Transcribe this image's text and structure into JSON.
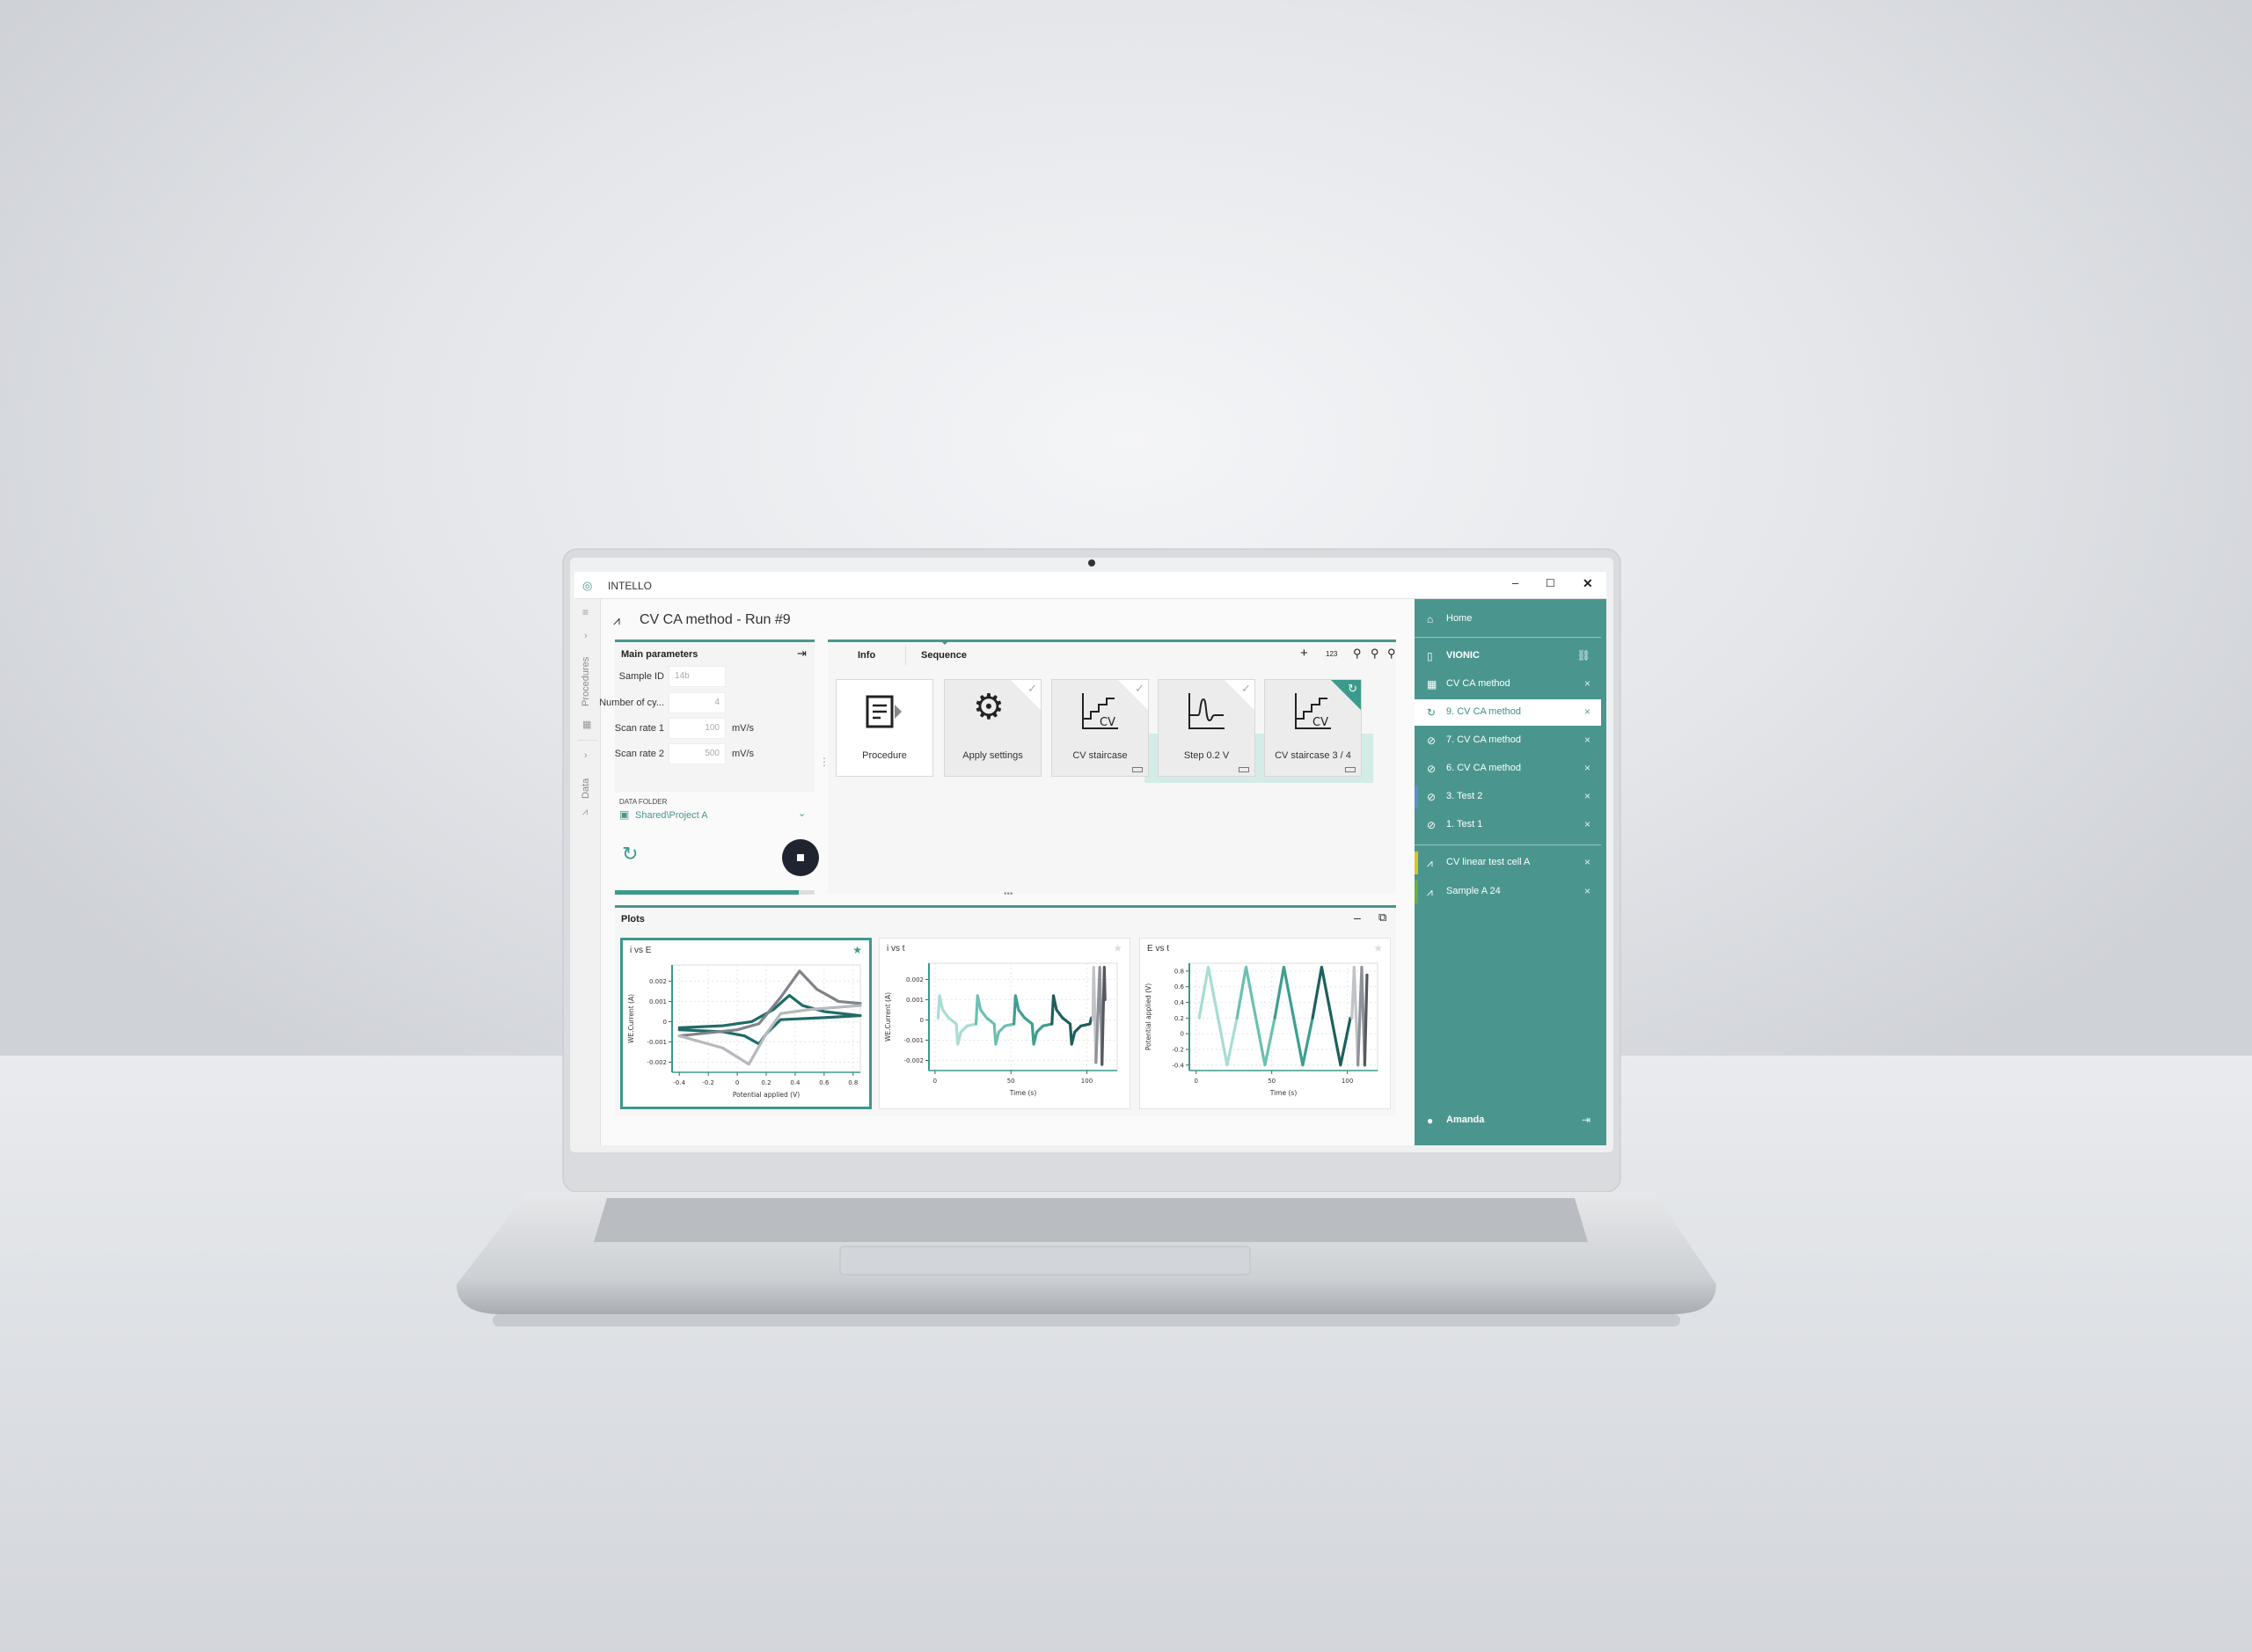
{
  "app": {
    "name": "INTELLO",
    "window_controls": [
      "minimize",
      "maximize",
      "close"
    ]
  },
  "nav": {
    "procedures": "Procedures",
    "data": "Data"
  },
  "run": {
    "title": "CV CA method - Run #9"
  },
  "params": {
    "heading": "Main parameters",
    "fields": [
      {
        "label": "Sample ID",
        "value": "14b",
        "unit": ""
      },
      {
        "label": "Number of cy...",
        "value": "4",
        "unit": ""
      },
      {
        "label": "Scan rate 1",
        "value": "100",
        "unit": "mV/s"
      },
      {
        "label": "Scan rate 2",
        "value": "500",
        "unit": "mV/s"
      }
    ],
    "data_folder_label": "DATA FOLDER",
    "data_folder": "Shared\\Project A",
    "progress": 0.92
  },
  "sequence": {
    "tabs": [
      {
        "label": "Info"
      },
      {
        "label": "Sequence",
        "active": true
      }
    ],
    "toolbar": [
      "add-icon",
      "numbering-icon",
      "zoom-fit-icon",
      "zoom-out-icon",
      "zoom-in-icon"
    ],
    "numbering_label": "123",
    "cards": [
      {
        "label": "Procedure",
        "state": "none",
        "icon": "procedure-icon"
      },
      {
        "label": "Apply settings",
        "state": "done",
        "icon": "gear-icon"
      },
      {
        "label": "CV staircase",
        "state": "done",
        "icon": "cv-staircase-icon",
        "icon_text": "CV"
      },
      {
        "label": "Step 0.2 V",
        "state": "done",
        "icon": "step-icon"
      },
      {
        "label": "CV staircase 3 / 4",
        "state": "running",
        "icon": "cv-staircase-icon",
        "icon_text": "CV"
      }
    ]
  },
  "plots": {
    "heading": "Plots"
  },
  "colors": {
    "accent": "#4a968e",
    "sidebar": "#4a968e",
    "stop": "#1e2430"
  },
  "sidebar": {
    "home": "Home",
    "instrument": "VIONIC",
    "items": [
      {
        "label": "CV CA method",
        "icon": "procedure-grid-icon"
      },
      {
        "label": "9. CV CA method",
        "icon": "running-icon",
        "active": true
      },
      {
        "label": "7. CV CA method",
        "icon": "check-circle-icon"
      },
      {
        "label": "6. CV CA method",
        "icon": "check-circle-icon"
      },
      {
        "label": "3. Test 2",
        "icon": "check-circle-icon",
        "color": "#5b8fcf"
      },
      {
        "label": "1. Test 1",
        "icon": "check-circle-icon"
      }
    ],
    "data_items": [
      {
        "label": "CV linear test cell A",
        "color": "#d8c430"
      },
      {
        "label": "Sample A 24",
        "color": "#6aae4c"
      }
    ],
    "user": "Amanda"
  },
  "chart_data": [
    {
      "type": "line",
      "title": "i vs E",
      "favorite": true,
      "xlabel": "Potential applied (V)",
      "ylabel": "WE.Current (A)",
      "xlim": [
        -0.45,
        0.85
      ],
      "ylim": [
        -0.0025,
        0.0028
      ],
      "xticks": [
        -0.4,
        -0.2,
        0,
        0.2,
        0.4,
        0.6,
        0.8
      ],
      "yticks": [
        -0.002,
        -0.001,
        0,
        0.001,
        0.002
      ],
      "grid": true,
      "series": [
        {
          "color": "#1f6b68",
          "points": [
            [
              -0.4,
              -0.0003
            ],
            [
              -0.1,
              -0.0002
            ],
            [
              0.1,
              0.0
            ],
            [
              0.25,
              0.0006
            ],
            [
              0.36,
              0.0013
            ],
            [
              0.45,
              0.0008
            ],
            [
              0.6,
              0.0005
            ],
            [
              0.85,
              0.0003
            ],
            [
              0.6,
              0.0002
            ],
            [
              0.3,
              0.0001
            ],
            [
              0.2,
              -0.0006
            ],
            [
              0.15,
              -0.0011
            ],
            [
              0.05,
              -0.0007
            ],
            [
              -0.1,
              -0.0005
            ],
            [
              -0.4,
              -0.0004
            ]
          ]
        },
        {
          "color": "#80838a",
          "points": [
            [
              -0.4,
              -0.0007
            ],
            [
              0,
              -0.0004
            ],
            [
              0.15,
              -0.0001
            ],
            [
              0.3,
              0.0012
            ],
            [
              0.43,
              0.0025
            ],
            [
              0.55,
              0.0016
            ],
            [
              0.7,
              0.001
            ],
            [
              0.85,
              0.0009
            ]
          ]
        },
        {
          "color": "#b5b8bd",
          "points": [
            [
              0.85,
              0.0008
            ],
            [
              0.5,
              0.0006
            ],
            [
              0.3,
              0.0004
            ],
            [
              0.2,
              -0.0006
            ],
            [
              0.08,
              -0.0021
            ],
            [
              -0.1,
              -0.0013
            ],
            [
              -0.4,
              -0.0007
            ]
          ]
        }
      ]
    },
    {
      "type": "line",
      "title": "i vs t",
      "favorite": false,
      "xlabel": "Time (s)",
      "ylabel": "WE.Current (A)",
      "xlim": [
        -4,
        120
      ],
      "ylim": [
        -0.0025,
        0.0028
      ],
      "xticks": [
        0,
        50,
        100
      ],
      "yticks": [
        -0.002,
        -0.001,
        0,
        0.001,
        0.002
      ],
      "grid": true,
      "series": [
        {
          "color": "#a8ddd3",
          "points": [
            [
              2,
              0.0001
            ],
            [
              3,
              0.0012
            ],
            [
              5,
              0.0005
            ],
            [
              9,
              0.0001
            ],
            [
              14,
              -0.0002
            ],
            [
              15,
              -0.0012
            ],
            [
              17,
              -0.0006
            ],
            [
              21,
              -0.0003
            ],
            [
              27,
              -0.0002
            ]
          ]
        },
        {
          "color": "#6cc0b0",
          "points": [
            [
              27,
              -0.0002
            ],
            [
              28,
              0.0012
            ],
            [
              30,
              0.0005
            ],
            [
              34,
              0.0001
            ],
            [
              39,
              -0.0002
            ],
            [
              40,
              -0.0012
            ],
            [
              42,
              -0.0006
            ],
            [
              46,
              -0.0003
            ],
            [
              52,
              -0.0002
            ]
          ]
        },
        {
          "color": "#3e9f90",
          "points": [
            [
              52,
              -0.0002
            ],
            [
              53,
              0.0012
            ],
            [
              55,
              0.0005
            ],
            [
              59,
              0.0001
            ],
            [
              64,
              -0.0002
            ],
            [
              65,
              -0.0012
            ],
            [
              67,
              -0.0006
            ],
            [
              71,
              -0.0003
            ],
            [
              77,
              -0.0002
            ]
          ]
        },
        {
          "color": "#1d5f5c",
          "points": [
            [
              77,
              -0.0002
            ],
            [
              78,
              0.0012
            ],
            [
              80,
              0.0005
            ],
            [
              84,
              0.0001
            ],
            [
              89,
              -0.0002
            ],
            [
              90,
              -0.0012
            ],
            [
              92,
              -0.0006
            ],
            [
              96,
              -0.0003
            ],
            [
              102,
              -0.0002
            ],
            [
              103,
              0.0001
            ]
          ]
        },
        {
          "color": "#c0c3c7",
          "points": [
            [
              104,
              0.0
            ],
            [
              104.5,
              0.0026
            ],
            [
              106,
              -0.0021
            ]
          ]
        },
        {
          "color": "#8f9298",
          "points": [
            [
              106,
              -0.0021
            ],
            [
              108.5,
              0.0026
            ],
            [
              110,
              -0.0022
            ]
          ]
        },
        {
          "color": "#55585e",
          "points": [
            [
              110,
              -0.0022
            ],
            [
              111.5,
              0.0026
            ],
            [
              112,
              0.001
            ]
          ]
        }
      ]
    },
    {
      "type": "line",
      "title": "E vs t",
      "favorite": false,
      "xlabel": "Time (s)",
      "ylabel": "Potential applied (V)",
      "xlim": [
        -4.5,
        120
      ],
      "ylim": [
        -0.47,
        0.9
      ],
      "xticks": [
        0,
        50,
        100
      ],
      "yticks": [
        -0.4,
        -0.2,
        0,
        0.2,
        0.4,
        0.6,
        0.8
      ],
      "grid": true,
      "series": [
        {
          "color": "#a8ddd3",
          "points": [
            [
              2,
              0.2
            ],
            [
              8,
              0.85
            ],
            [
              20.5,
              -0.4
            ],
            [
              27,
              0.2
            ]
          ]
        },
        {
          "color": "#6cc0b0",
          "points": [
            [
              27,
              0.2
            ],
            [
              33,
              0.85
            ],
            [
              45.5,
              -0.4
            ],
            [
              52,
              0.2
            ]
          ]
        },
        {
          "color": "#3e9f90",
          "points": [
            [
              52,
              0.2
            ],
            [
              58,
              0.85
            ],
            [
              70.5,
              -0.4
            ],
            [
              77,
              0.2
            ]
          ]
        },
        {
          "color": "#1d5f5c",
          "points": [
            [
              77,
              0.2
            ],
            [
              83,
              0.85
            ],
            [
              95.5,
              -0.4
            ],
            [
              102,
              0.2
            ]
          ]
        },
        {
          "color": "#c0c3c7",
          "points": [
            [
              103,
              0.2
            ],
            [
              104.5,
              0.85
            ],
            [
              107,
              -0.4
            ]
          ]
        },
        {
          "color": "#8f9298",
          "points": [
            [
              107,
              -0.4
            ],
            [
              109.5,
              0.85
            ],
            [
              111.5,
              -0.4
            ]
          ]
        },
        {
          "color": "#55585e",
          "points": [
            [
              111.5,
              -0.4
            ],
            [
              113,
              0.75
            ]
          ]
        }
      ]
    }
  ]
}
